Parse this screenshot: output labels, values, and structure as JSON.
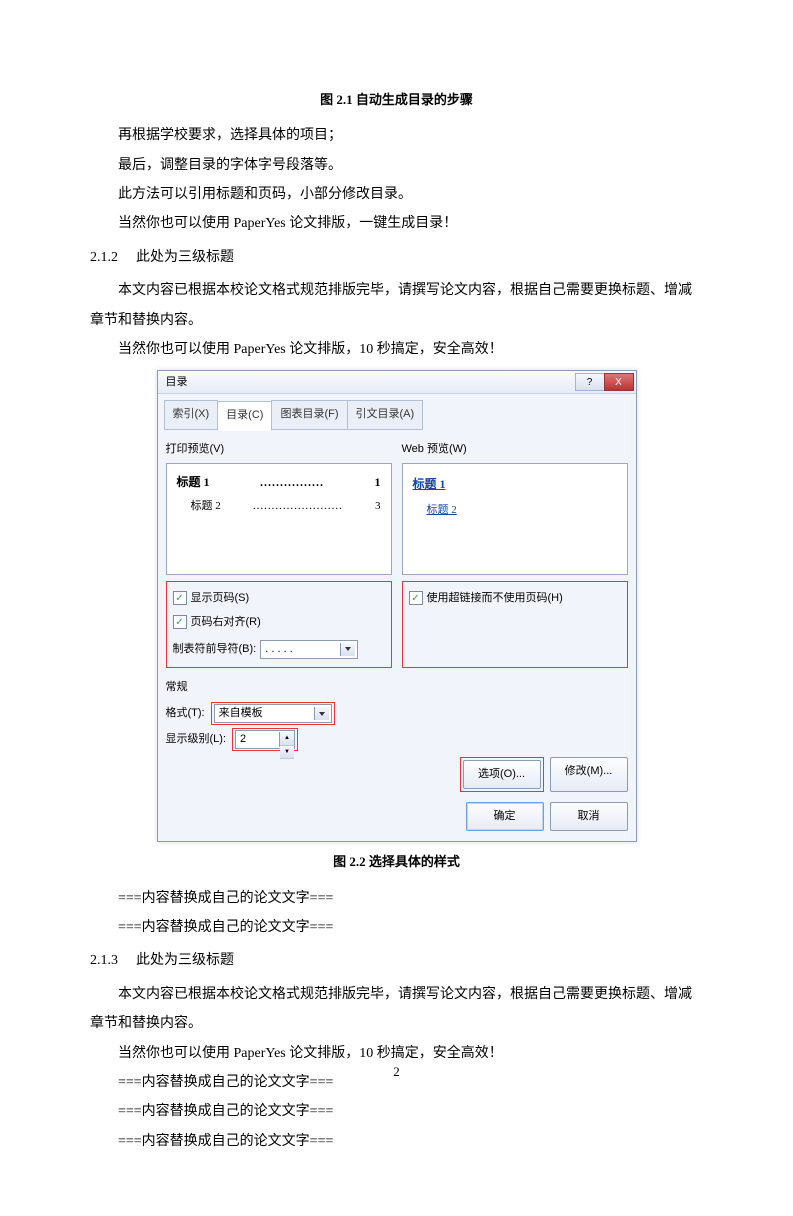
{
  "caption1": "图 2.1  自动生成目录的步骤",
  "para1": "再根据学校要求，选择具体的项目；",
  "para2": "最后，调整目录的字体字号段落等。",
  "para3": "此方法可以引用标题和页码，小部分修改目录。",
  "para4": "当然你也可以使用 PaperYes 论文排版，一键生成目录！",
  "h212_num": "2.1.2",
  "h212_title": "此处为三级标题",
  "para5": "本文内容已根据本校论文格式规范排版完毕，请撰写论文内容，根据自己需要更换标题、增减章节和替换内容。",
  "para6": "当然你也可以使用 PaperYes 论文排版，10 秒搞定，安全高效！",
  "dialog": {
    "title": "目录",
    "help_btn": "?",
    "close_btn": "X",
    "tabs": {
      "t1": "索引(X)",
      "t2": "目录(C)",
      "t3": "图表目录(F)",
      "t4": "引文目录(A)"
    },
    "print_preview_label": "打印预览(V)",
    "web_preview_label": "Web 预览(W)",
    "print_preview": {
      "l1_left": "标题 1",
      "l1_right": "1",
      "l2_left": "标题 2",
      "l2_right": "3"
    },
    "web_preview": {
      "link1": "标题 1",
      "link2": "标题 2"
    },
    "chk_show_page": "显示页码(S)",
    "chk_right_align": "页码右对齐(R)",
    "chk_hyperlink": "使用超链接而不使用页码(H)",
    "leader_label": "制表符前导符(B):",
    "leader_value": ". . . . .",
    "general_label": "常规",
    "format_label": "格式(T):",
    "format_value": "来自模板",
    "level_label": "显示级别(L):",
    "level_value": "2",
    "options_btn": "选项(O)...",
    "modify_btn": "修改(M)...",
    "ok_btn": "确定",
    "cancel_btn": "取消"
  },
  "caption2": "图 2.2  选择具体的样式",
  "placeholder": "===内容替换成自己的论文文字===",
  "h213_num": "2.1.3",
  "h213_title": "此处为三级标题",
  "para7": "本文内容已根据本校论文格式规范排版完毕，请撰写论文内容，根据自己需要更换标题、增减章节和替换内容。",
  "para8": "当然你也可以使用 PaperYes 论文排版，10 秒搞定，安全高效！",
  "page_number": "2"
}
